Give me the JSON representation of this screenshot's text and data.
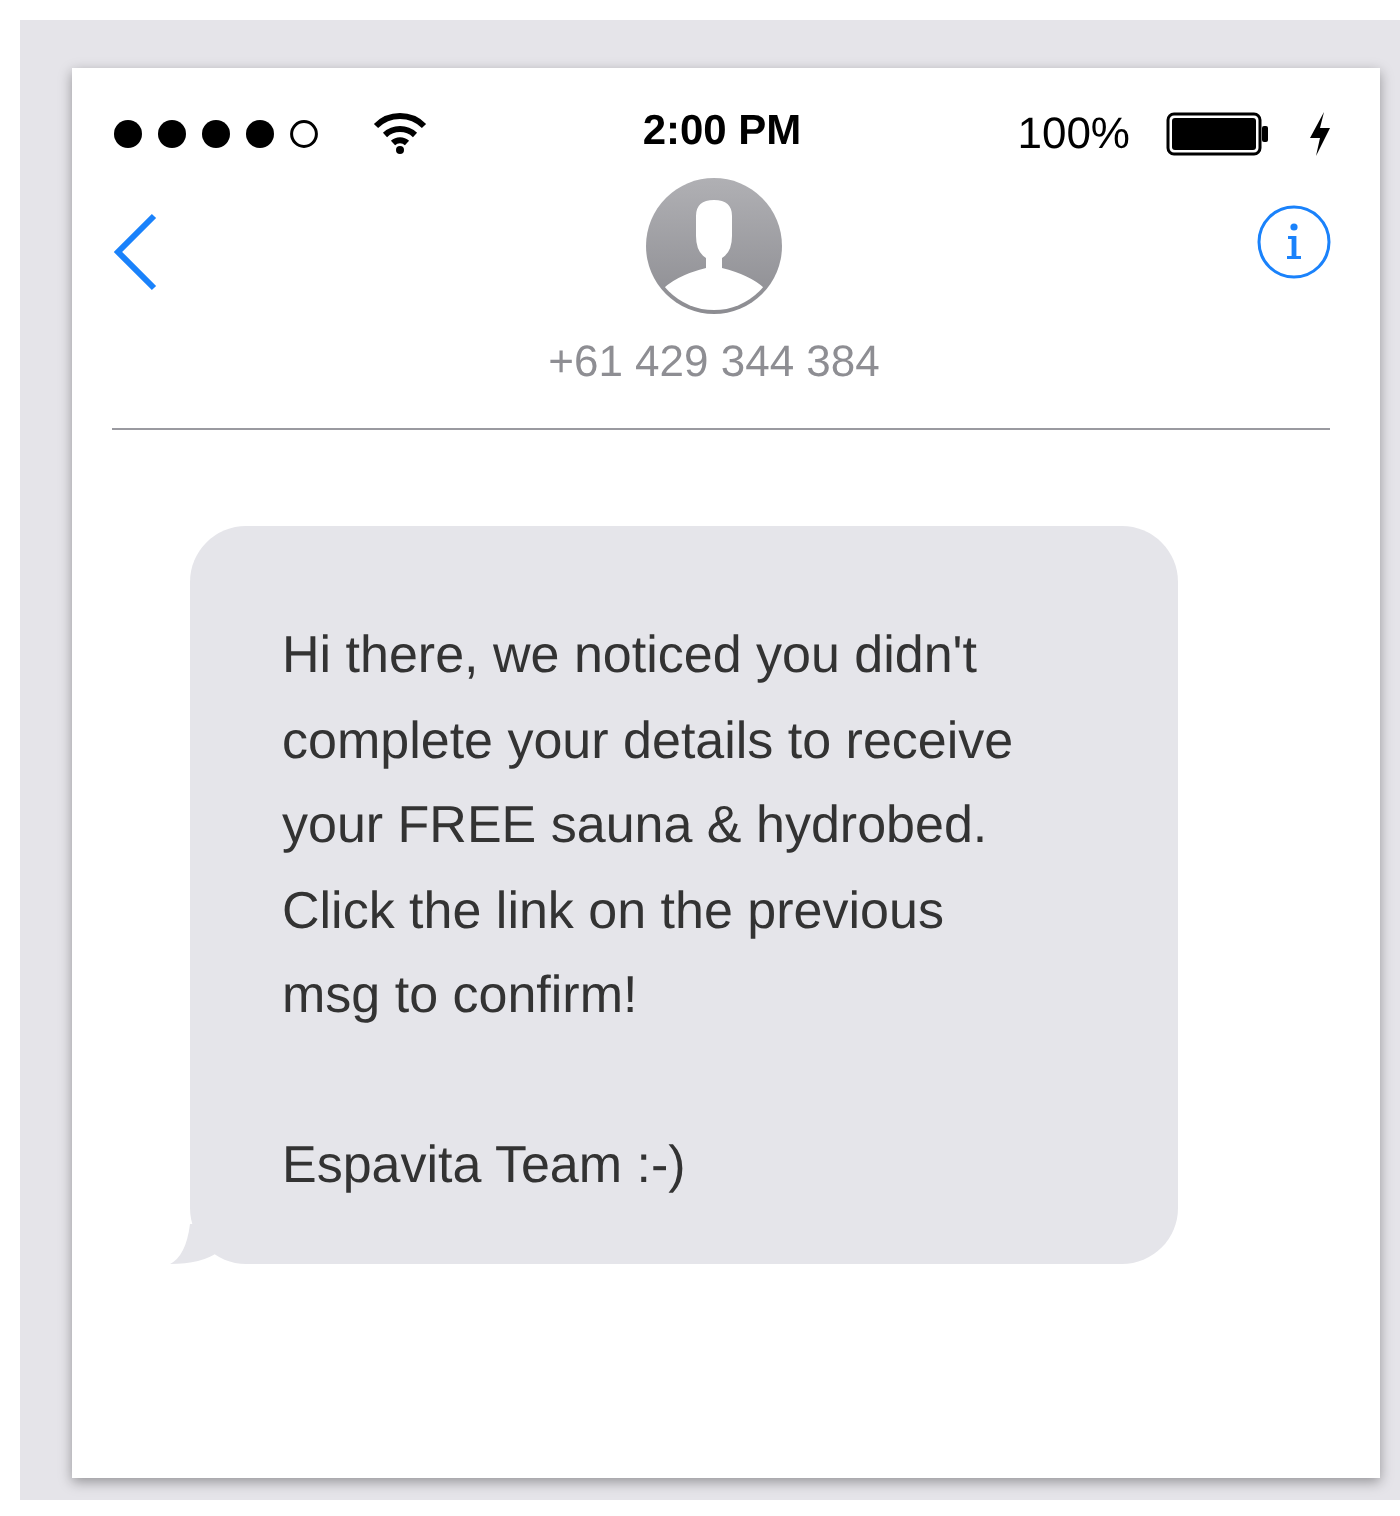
{
  "status_bar": {
    "time": "2:00 PM",
    "battery": "100%"
  },
  "contact": {
    "phone": "+61 429 344 384"
  },
  "messages": [
    {
      "kind": "received",
      "text": "Hi there, we noticed you didn't\ncomplete your details to receive\nyour FREE sauna & hydrobed.\nClick the link on the previous\nmsg to confirm!\n\nEspavita Team :-)"
    }
  ]
}
